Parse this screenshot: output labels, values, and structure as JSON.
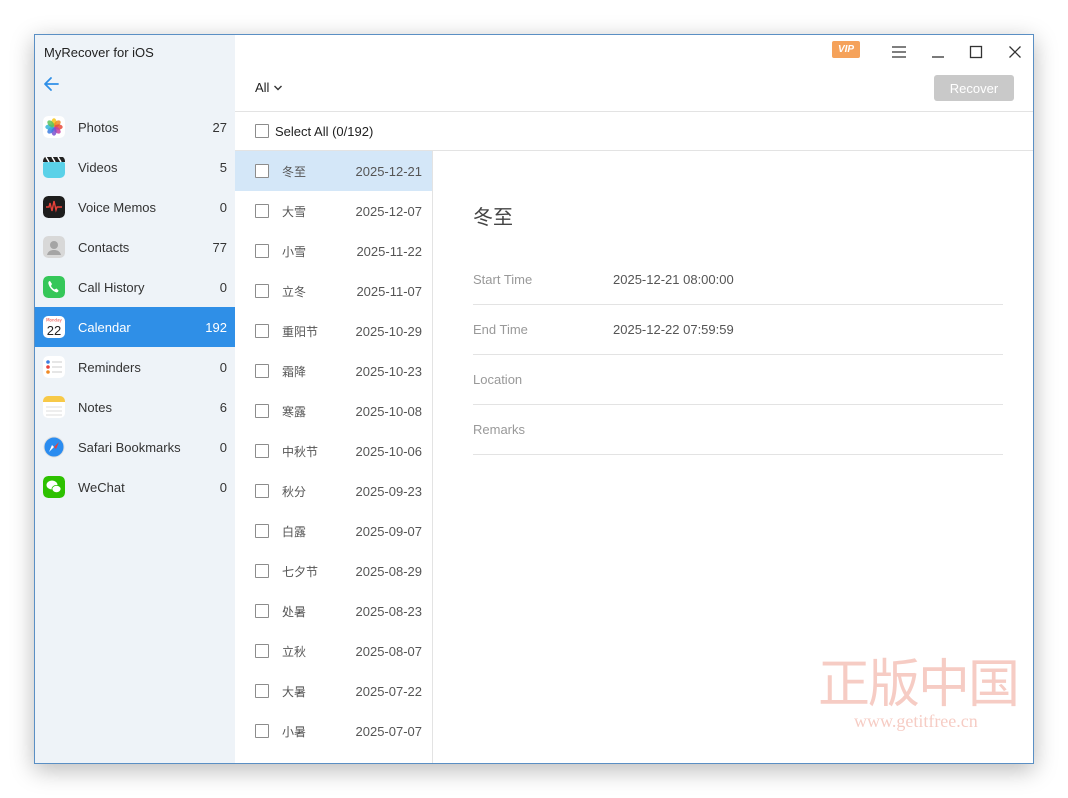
{
  "app": {
    "title": "MyRecover for iOS"
  },
  "topbar": {
    "vip": "VIP",
    "filter": "All",
    "recover_label": "Recover"
  },
  "categories": [
    {
      "label": "Photos",
      "count": "27",
      "icon": "photos-icon"
    },
    {
      "label": "Videos",
      "count": "5",
      "icon": "videos-icon"
    },
    {
      "label": "Voice Memos",
      "count": "0",
      "icon": "voice-memos-icon"
    },
    {
      "label": "Contacts",
      "count": "77",
      "icon": "contacts-icon"
    },
    {
      "label": "Call History",
      "count": "0",
      "icon": "phone-icon"
    },
    {
      "label": "Calendar",
      "count": "192",
      "icon": "calendar-icon",
      "calendar_day": "22",
      "active": true
    },
    {
      "label": "Reminders",
      "count": "0",
      "icon": "reminders-icon"
    },
    {
      "label": "Notes",
      "count": "6",
      "icon": "notes-icon"
    },
    {
      "label": "Safari Bookmarks",
      "count": "0",
      "icon": "safari-icon"
    },
    {
      "label": "WeChat",
      "count": "0",
      "icon": "wechat-icon"
    }
  ],
  "select_all": {
    "label": "Select All (0/192)"
  },
  "events": [
    {
      "name": "冬至",
      "date": "2025-12-21",
      "selected": true
    },
    {
      "name": "大雪",
      "date": "2025-12-07"
    },
    {
      "name": "小雪",
      "date": "2025-11-22"
    },
    {
      "name": "立冬",
      "date": "2025-11-07"
    },
    {
      "name": "重阳节",
      "date": "2025-10-29"
    },
    {
      "name": "霜降",
      "date": "2025-10-23"
    },
    {
      "name": "寒露",
      "date": "2025-10-08"
    },
    {
      "name": "中秋节",
      "date": "2025-10-06"
    },
    {
      "name": "秋分",
      "date": "2025-09-23"
    },
    {
      "name": "白露",
      "date": "2025-09-07"
    },
    {
      "name": "七夕节",
      "date": "2025-08-29"
    },
    {
      "name": "处暑",
      "date": "2025-08-23"
    },
    {
      "name": "立秋",
      "date": "2025-08-07"
    },
    {
      "name": "大暑",
      "date": "2025-07-22"
    },
    {
      "name": "小暑",
      "date": "2025-07-07"
    }
  ],
  "detail": {
    "title": "冬至",
    "rows": [
      {
        "label": "Start Time",
        "value": "2025-12-21 08:00:00"
      },
      {
        "label": "End Time",
        "value": "2025-12-22 07:59:59"
      },
      {
        "label": "Location",
        "value": ""
      },
      {
        "label": "Remarks",
        "value": ""
      }
    ]
  },
  "watermark": {
    "text": "正版中国",
    "url": "www.getitfree.cn"
  },
  "colors": {
    "accent": "#2f8fe7",
    "selected_row": "#d4e7f8",
    "sidebar_bg": "#eef3f8",
    "vip": "#f5a25a",
    "recover_disabled": "#c9c9c9"
  }
}
